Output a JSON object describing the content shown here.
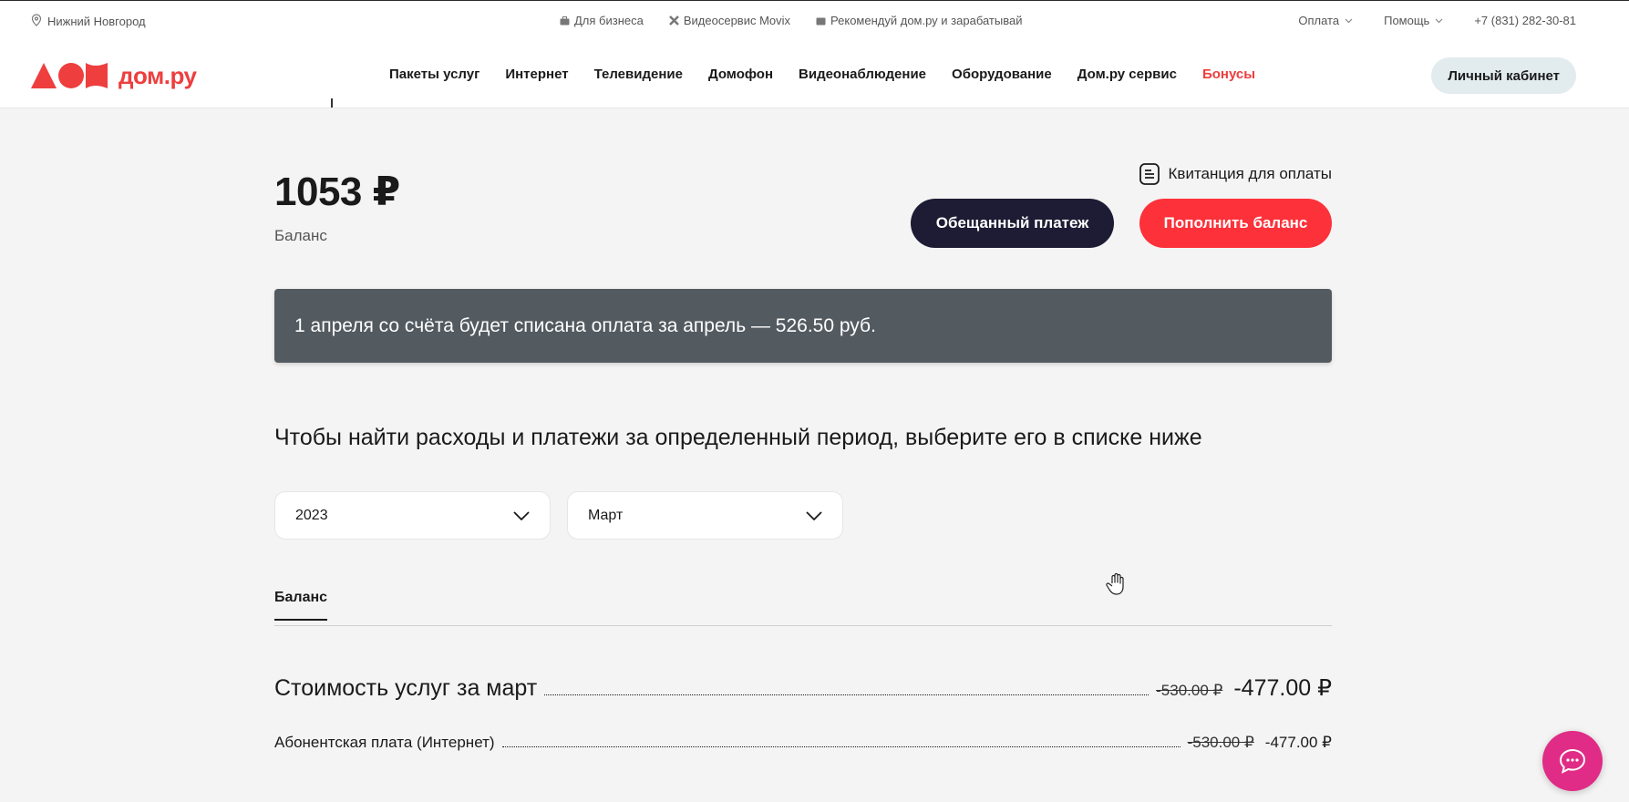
{
  "topbar": {
    "city": "Нижний Новгород",
    "links": [
      "Для бизнеса",
      "Видеосервис Movix",
      "Рекомендуй дом.ру и зарабатывай"
    ],
    "payment": "Оплата",
    "help": "Помощь",
    "phone": "+7 (831) 282-30-81"
  },
  "nav": {
    "logo_text": "дом.ру",
    "brand_color": "#ee3e3e",
    "items": [
      "Пакеты услуг",
      "Интернет",
      "Телевидение",
      "Домофон",
      "Видеонаблюдение",
      "Оборудование",
      "Дом.ру сервис"
    ],
    "bonus": "Бонусы",
    "cabinet": "Личный кабинет"
  },
  "balance": {
    "amount": "1053 ₽",
    "label": "Баланс",
    "receipt_link": "Квитанция для оплаты",
    "promise_button": "Обещанный платеж",
    "topup_button": "Пополнить баланс"
  },
  "notice": "1 апреля со счёта будет списана оплата за апрель — 526.50 руб.",
  "period": {
    "heading": "Чтобы найти расходы и платежи за определенный период, выберите его в списке ниже",
    "year": "2023",
    "month": "Март"
  },
  "tabs": [
    "Баланс"
  ],
  "costs": {
    "title": "Стоимость услуг за март",
    "title_old": "-530.00 ₽",
    "title_new": "-477.00 ₽",
    "rows": [
      {
        "label": "Абонентская плата (Интернет)",
        "old": "-530.00 ₽",
        "new": "-477.00 ₽"
      }
    ]
  },
  "icons": [
    "location-pin-icon",
    "briefcase-icon",
    "movix-icon",
    "wallet-icon",
    "chevron-down-icon",
    "receipt-icon",
    "chat-icon",
    "hand-cursor-icon"
  ]
}
